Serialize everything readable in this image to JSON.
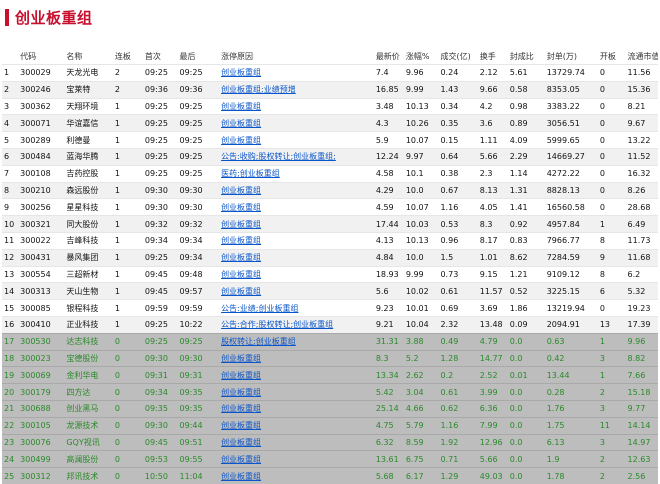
{
  "title": "创业板重组",
  "colors": {
    "accent": "#c8102e",
    "link": "#0a55c9",
    "highlight_text": "#2a8a2a"
  },
  "columns": [
    "",
    "代码",
    "名称",
    "连板",
    "首次",
    "最后",
    "涨停原因",
    "最新价",
    "涨幅%",
    "成交(亿)",
    "换手",
    "封成比",
    "封单(万)",
    "开板",
    "流通市值"
  ],
  "rows": [
    [
      "1",
      "300029",
      "天龙光电",
      "2",
      "09:25",
      "09:25",
      "创业板重组",
      "7.4",
      "9.96",
      "0.24",
      "2.12",
      "5.61",
      "13729.74",
      "0",
      "11.56"
    ],
    [
      "2",
      "300246",
      "宝莱特",
      "2",
      "09:36",
      "09:36",
      "创业板重组;业绩预增",
      "16.85",
      "9.99",
      "1.43",
      "9.66",
      "0.58",
      "8353.05",
      "0",
      "15.36"
    ],
    [
      "3",
      "300362",
      "天翔环境",
      "1",
      "09:25",
      "09:25",
      "创业板重组",
      "3.48",
      "10.13",
      "0.34",
      "4.2",
      "0.98",
      "3383.22",
      "0",
      "8.21"
    ],
    [
      "4",
      "300071",
      "华谊嘉信",
      "1",
      "09:25",
      "09:25",
      "创业板重组",
      "4.3",
      "10.26",
      "0.35",
      "3.6",
      "0.89",
      "3056.51",
      "0",
      "9.67"
    ],
    [
      "5",
      "300289",
      "利德曼",
      "1",
      "09:25",
      "09:25",
      "创业板重组",
      "5.9",
      "10.07",
      "0.15",
      "1.11",
      "4.09",
      "5999.65",
      "0",
      "13.22"
    ],
    [
      "6",
      "300484",
      "蓝海华腾",
      "1",
      "09:25",
      "09:25",
      "公告:收购;股权转让;创业板重组;",
      "12.24",
      "9.97",
      "0.64",
      "5.66",
      "2.29",
      "14669.27",
      "0",
      "11.52"
    ],
    [
      "7",
      "300108",
      "吉药控股",
      "1",
      "09:25",
      "09:25",
      "医药;创业板重组",
      "4.58",
      "10.1",
      "0.38",
      "2.3",
      "1.14",
      "4272.22",
      "0",
      "16.32"
    ],
    [
      "8",
      "300210",
      "森远股份",
      "1",
      "09:30",
      "09:30",
      "创业板重组",
      "4.29",
      "10.0",
      "0.67",
      "8.13",
      "1.31",
      "8828.13",
      "0",
      "8.26"
    ],
    [
      "9",
      "300256",
      "星星科技",
      "1",
      "09:30",
      "09:30",
      "创业板重组",
      "4.59",
      "10.07",
      "1.16",
      "4.05",
      "1.41",
      "16560.58",
      "0",
      "28.68"
    ],
    [
      "10",
      "300321",
      "同大股份",
      "1",
      "09:32",
      "09:32",
      "创业板重组",
      "17.44",
      "10.03",
      "0.53",
      "8.3",
      "0.92",
      "4957.84",
      "1",
      "6.49"
    ],
    [
      "11",
      "300022",
      "吉峰科技",
      "1",
      "09:34",
      "09:34",
      "创业板重组",
      "4.13",
      "10.13",
      "0.96",
      "8.17",
      "0.83",
      "7966.77",
      "8",
      "11.73"
    ],
    [
      "12",
      "300431",
      "暴风集团",
      "1",
      "09:25",
      "09:34",
      "创业板重组",
      "4.84",
      "10.0",
      "1.5",
      "1.01",
      "8.62",
      "7284.59",
      "9",
      "11.68"
    ],
    [
      "13",
      "300554",
      "三超新材",
      "1",
      "09:45",
      "09:48",
      "创业板重组",
      "18.93",
      "9.99",
      "0.73",
      "9.15",
      "1.21",
      "9109.12",
      "8",
      "6.2"
    ],
    [
      "14",
      "300313",
      "天山生物",
      "1",
      "09:45",
      "09:57",
      "创业板重组",
      "5.6",
      "10.02",
      "0.61",
      "11.57",
      "0.52",
      "3225.15",
      "6",
      "5.32"
    ],
    [
      "15",
      "300085",
      "银程科技",
      "1",
      "09:59",
      "09:59",
      "公告:业绩;创业板重组",
      "9.23",
      "10.01",
      "0.69",
      "3.69",
      "1.86",
      "13219.94",
      "0",
      "19.23"
    ],
    [
      "16",
      "300410",
      "正业科技",
      "1",
      "09:25",
      "10:22",
      "公告:合作;股权转让;创业板重组",
      "9.21",
      "10.04",
      "2.32",
      "13.48",
      "0.09",
      "2094.91",
      "13",
      "17.39"
    ],
    [
      "17",
      "300530",
      "达志科技",
      "0",
      "09:25",
      "09:25",
      "股权转让;创业板重组",
      "31.31",
      "3.88",
      "0.49",
      "4.79",
      "0.0",
      "0.63",
      "1",
      "9.96"
    ],
    [
      "18",
      "300023",
      "宝德股份",
      "0",
      "09:30",
      "09:30",
      "创业板重组",
      "8.3",
      "5.2",
      "1.28",
      "14.77",
      "0.0",
      "0.42",
      "3",
      "8.82"
    ],
    [
      "19",
      "300069",
      "金利华电",
      "0",
      "09:31",
      "09:31",
      "创业板重组",
      "13.34",
      "2.62",
      "0.2",
      "2.52",
      "0.01",
      "13.44",
      "1",
      "7.66"
    ],
    [
      "20",
      "300179",
      "四方达",
      "0",
      "09:34",
      "09:35",
      "创业板重组",
      "5.42",
      "3.04",
      "0.61",
      "3.99",
      "0.0",
      "0.28",
      "2",
      "15.18"
    ],
    [
      "21",
      "300688",
      "创业黑马",
      "0",
      "09:35",
      "09:35",
      "创业板重组",
      "25.14",
      "4.66",
      "0.62",
      "6.36",
      "0.0",
      "1.76",
      "3",
      "9.77"
    ],
    [
      "22",
      "300105",
      "龙源技术",
      "0",
      "09:30",
      "09:44",
      "创业板重组",
      "4.75",
      "5.79",
      "1.16",
      "7.99",
      "0.0",
      "1.75",
      "11",
      "14.14"
    ],
    [
      "23",
      "300076",
      "GQY视讯",
      "0",
      "09:45",
      "09:51",
      "创业板重组",
      "6.32",
      "8.59",
      "1.92",
      "12.96",
      "0.0",
      "6.13",
      "3",
      "14.97"
    ],
    [
      "24",
      "300499",
      "高澜股份",
      "0",
      "09:53",
      "09:55",
      "创业板重组",
      "13.61",
      "6.75",
      "0.71",
      "5.66",
      "0.0",
      "1.9",
      "2",
      "12.63"
    ],
    [
      "25",
      "300312",
      "邦讯技术",
      "0",
      "10:50",
      "11:04",
      "创业板重组",
      "5.68",
      "6.17",
      "1.29",
      "49.03",
      "0.0",
      "1.78",
      "2",
      "2.56"
    ]
  ]
}
